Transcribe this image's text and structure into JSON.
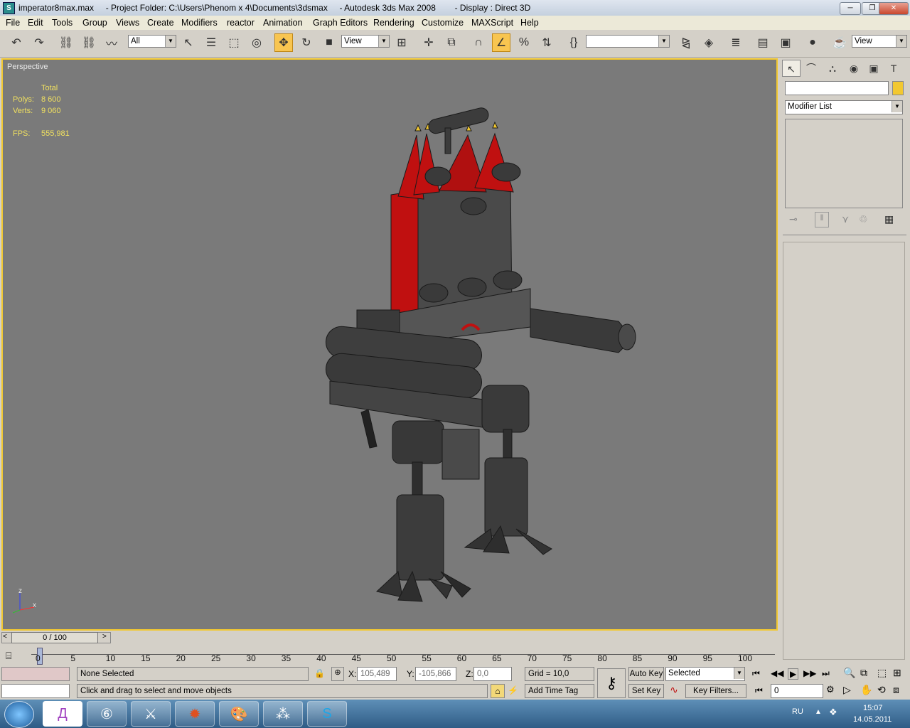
{
  "window": {
    "title": "imperator8max.max     - Project Folder: C:\\Users\\Phenom x 4\\Documents\\3dsmax     - Autodesk 3ds Max 2008        - Display : Direct 3D",
    "minimize": "─",
    "maximize": "❐",
    "close": "✕"
  },
  "menu": [
    "File",
    "Edit",
    "Tools",
    "Group",
    "Views",
    "Create",
    "Modifiers",
    "reactor",
    "Animation",
    "Graph Editors",
    "Rendering",
    "Customize",
    "MAXScript",
    "Help"
  ],
  "toolbar": {
    "selection_filter": "All",
    "ref_coord": "View",
    "named_sel": "",
    "ref_coord_right": "View"
  },
  "viewport": {
    "label": "Perspective",
    "stats": {
      "total_label": "Total",
      "polys_label": "Polys:",
      "polys_value": "8 600",
      "verts_label": "Verts:",
      "verts_value": "9 060",
      "fps_label": "FPS:",
      "fps_value": "555,981"
    },
    "axis_z": "z",
    "axis_x": "x"
  },
  "command_panel": {
    "name_field": "",
    "modifier_list": "Modifier List"
  },
  "time": {
    "slider_label": "0 / 100",
    "slider_prev": "<",
    "slider_next": ">",
    "ticks": [
      "0",
      "5",
      "10",
      "15",
      "20",
      "25",
      "30",
      "35",
      "40",
      "45",
      "50",
      "55",
      "60",
      "65",
      "70",
      "75",
      "80",
      "85",
      "90",
      "95",
      "100"
    ]
  },
  "status": {
    "selection": "None Selected",
    "prompt": "Click and drag to select and move objects",
    "x_label": "X:",
    "x_value": "105,489",
    "y_label": "Y:",
    "y_value": "-105,866",
    "z_label": "Z:",
    "z_value": "0,0",
    "grid": "Grid = 10,0",
    "add_time_tag": "Add Time Tag",
    "auto_key": "Auto Key",
    "set_key": "Set Key",
    "key_mode": "Selected",
    "key_filters": "Key Filters...",
    "frame": "0"
  },
  "taskbar": {
    "lang": "RU",
    "time": "15:07",
    "date": "14.05.2011"
  },
  "colors": {
    "viewport_bg": "#7a7a7a",
    "active_border": "#f2c830",
    "stats_text": "#f0e060",
    "model_red": "#c01010",
    "model_gray": "#3c3c3c"
  }
}
